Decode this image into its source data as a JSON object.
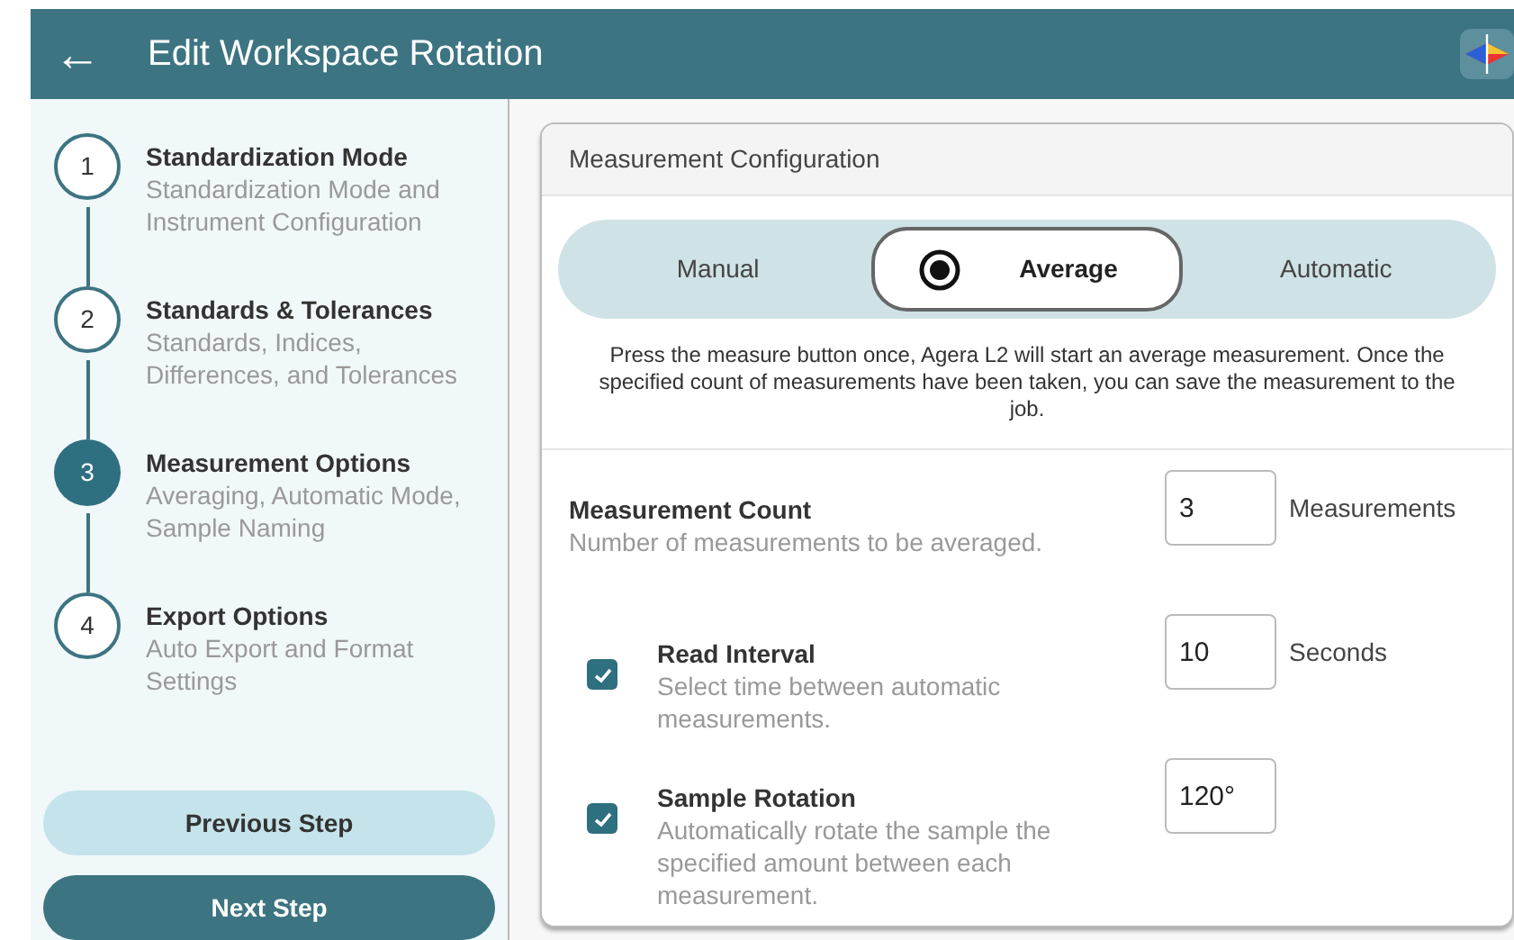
{
  "header": {
    "back": "←",
    "title": "Edit Workspace Rotation"
  },
  "steps": [
    {
      "number": "1",
      "title": "Standardization Mode",
      "subtitle": "Standardization Mode and Instrument Configuration",
      "selected": false
    },
    {
      "number": "2",
      "title": "Standards & Tolerances",
      "subtitle": "Standards, Indices, Differences, and Tolerances",
      "selected": false
    },
    {
      "number": "3",
      "title": "Measurement Options",
      "subtitle": "Averaging, Automatic Mode, Sample Naming",
      "selected": true
    },
    {
      "number": "4",
      "title": "Export Options",
      "subtitle": "Auto Export and Format Settings",
      "selected": false
    }
  ],
  "nav_buttons": [
    {
      "label": "Previous Step",
      "kind": "secondary"
    },
    {
      "label": "Next Step",
      "kind": "primary"
    }
  ],
  "card": {
    "title": "Measurement Configuration",
    "modes": [
      {
        "label": "Manual",
        "selected": false
      },
      {
        "label": "Average",
        "selected": true
      },
      {
        "label": "Automatic",
        "selected": false
      }
    ],
    "description": "Press the measure button once, Agera L2 will start an average measurement. Once the specified count of measurements have been taken, you can save the measurement to the job.",
    "settings": [
      {
        "kind": "plain",
        "title": "Measurement Count",
        "subtitle": "Number of measurements to be averaged.",
        "value": "3",
        "unit": "Measurements"
      },
      {
        "kind": "checkbox",
        "checked": true,
        "title": "Read Interval",
        "subtitle": "Select time between automatic measurements.",
        "value": "10",
        "unit": "Seconds"
      },
      {
        "kind": "checkbox",
        "checked": true,
        "title": "Sample Rotation",
        "subtitle": "Automatically rotate the sample the specified amount between each measurement.",
        "value": "120°"
      }
    ]
  }
}
